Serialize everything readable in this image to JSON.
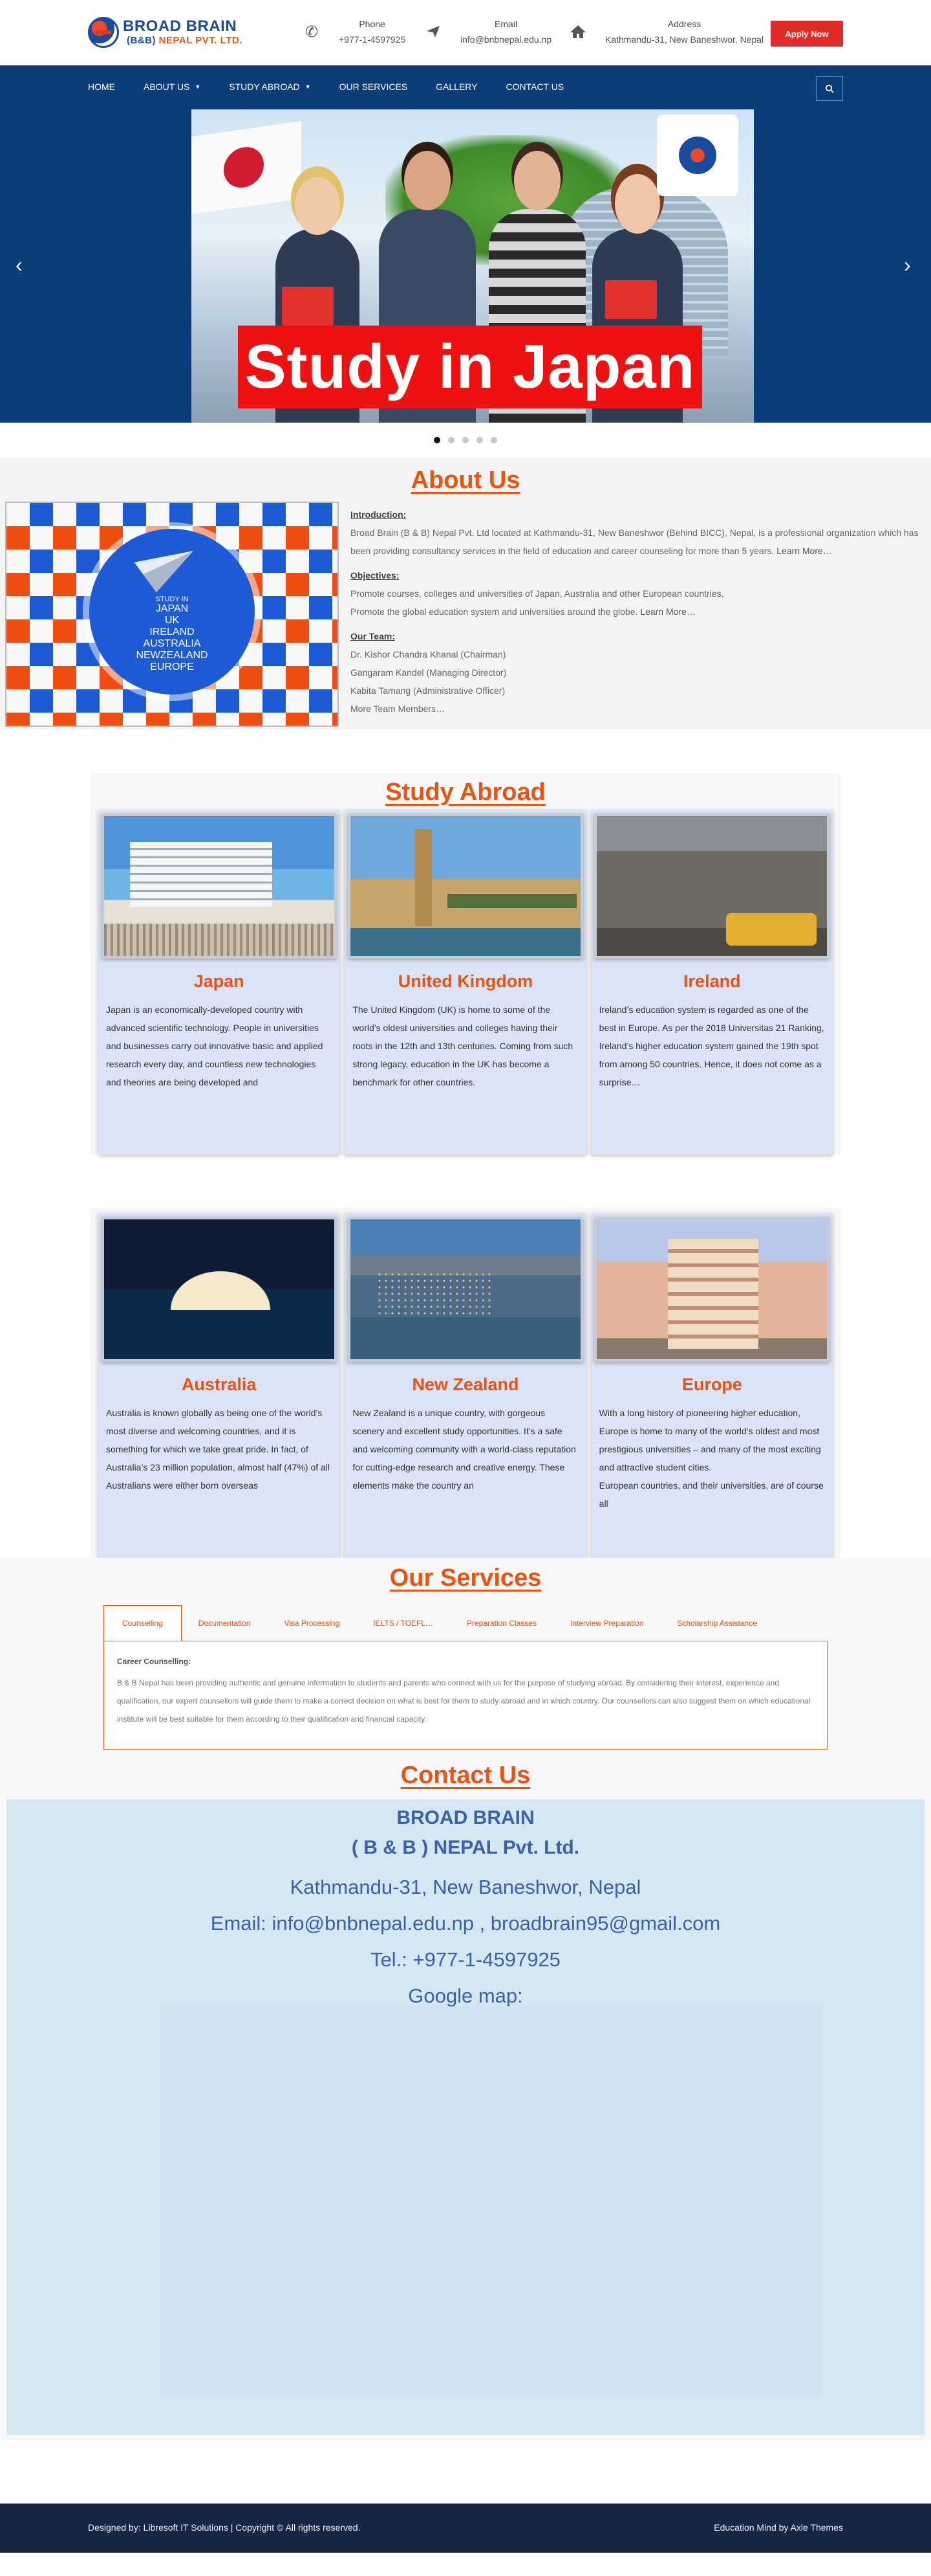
{
  "header": {
    "logo": {
      "line1": "BROAD BRAIN",
      "line2_a": "(B&B)",
      "line2_b": " NEPAL PVT. LTD."
    },
    "phone": {
      "label": "Phone",
      "value": "+977-1-4597925",
      "icon": "phone-icon"
    },
    "email": {
      "label": "Email",
      "value": "info@bnbnepal.edu.np",
      "icon": "paper-plane-icon"
    },
    "address": {
      "label": "Address",
      "value": "Kathmandu-31, New Baneshwor, Nepal",
      "icon": "home-icon"
    },
    "apply_label": "Apply Now"
  },
  "nav": {
    "items": [
      {
        "label": "HOME"
      },
      {
        "label": "ABOUT US"
      },
      {
        "label": "STUDY ABROAD"
      },
      {
        "label": "OUR SERVICES"
      },
      {
        "label": "GALLERY"
      },
      {
        "label": "CONTACT US"
      }
    ],
    "search_icon": "search-icon"
  },
  "slider": {
    "caption": "Study in Japan",
    "prev": "‹",
    "next": "›",
    "dots": 5,
    "active_dot": 1
  },
  "about": {
    "title": "About Us",
    "image_lines": [
      "STUDY IN",
      "JAPAN",
      "UK",
      "IRELAND",
      "AUSTRALIA",
      "NEWZEALAND",
      "EUROPE"
    ],
    "intro_heading": "Introduction:",
    "intro_text": "Broad Brain (B & B) Nepal Pvt. Ltd located at Kathmandu-31, New Baneshwor (Behind BICC), Nepal, is a professional organization which has been providing consultancy services in the field of education and career counseling for more than 5 years.",
    "intro_more": " Learn More…",
    "objectives_heading": "Objectives:",
    "objective_1": "Promote courses, colleges and universities of Japan, Australia and other European countries.",
    "objective_2": "Promote the global education system and universities around the globe.",
    "objective_more": " Learn More…",
    "team_heading": "Our Team:",
    "team_1": "Dr. Kishor Chandra Khanal  (Chairman)",
    "team_2": "Gangaram Kandel  (Managing Director)",
    "team_3": "Kabita Tamang  (Administrative Officer)",
    "team_more": "More Team Members…"
  },
  "abroad": {
    "title": "Study Abroad",
    "cards": [
      {
        "title": "Japan",
        "text": "Japan is an economically-developed country with advanced scientific technology. People in universities and businesses carry out innovative basic and applied research every day, and countless new technologies and theories are being developed and"
      },
      {
        "title": "United Kingdom",
        "text": "The United Kingdom (UK) is home to some of the world’s oldest universities and colleges having their roots in the 12th and 13th centuries. Coming from such strong legacy, education in the UK has become a benchmark for other countries."
      },
      {
        "title": "Ireland",
        "text": "Ireland’s education system is regarded as one of the best in Europe. As per the 2018 Universitas 21 Ranking, Ireland’s higher education system gained the 19th spot from among 50 countries. Hence, it does not come as a surprise…"
      },
      {
        "title": "Australia",
        "text": "Australia is known globally as being one of the world’s most diverse and welcoming countries, and it is something for which we take great pride. In fact, of Australia’s 23 million population, almost half (47%) of all Australians were either born overseas"
      },
      {
        "title": "New Zealand",
        "text": "New Zealand is a unique country, with gorgeous scenery and excellent study opportunities. It’s a safe and welcoming community with a world-class reputation for cutting-edge research and creative energy. These elements make the country an"
      },
      {
        "title": "Europe",
        "text": "With a long history of pioneering higher education, Europe is home to many of the world’s oldest and most prestigious universities – and many of the most exciting and attractive student cities.\nEuropean countries, and their universities, are of course all"
      }
    ]
  },
  "services": {
    "title": "Our Services",
    "tabs": [
      "Counselling",
      "Documentation",
      "Visa Processing",
      "IELTS / TOEFL…",
      "Preparation Classes",
      "Interview Preparation",
      "Scholarship Assistance"
    ],
    "panel_title": "Career Counselling:",
    "panel_text": "B & B Nepal has been providing authentic and genuine information to students and parents who connect with us for the purpose of studying abroad. By considering their interest, experience and qualification, our expert counsellors will guide them to make a correct decision on what is best for them to study abroad and in which country. Our counsellors can also suggest them on which educational institute will be best suitable for them according to their qualification and financial capacity."
  },
  "contact": {
    "title": "Contact Us",
    "name1": "BROAD BRAIN",
    "name2": "( B & B ) NEPAL Pvt. Ltd.",
    "address": "Kathmandu-31, New Baneshwor, Nepal",
    "email": "Email: info@bnbnepal.edu.np , broadbrain95@gmail.com",
    "tel": "Tel.: +977-1-4597925",
    "map_label": "Google map:"
  },
  "footer": {
    "left": "Designed by: Libresoft IT Solutions | Copyright © All rights reserved.",
    "right": "Education Mind by Axle Themes"
  },
  "colors": {
    "accent": "#ea5412",
    "nav_bg": "#0b3d7a",
    "apply_bg": "#e32a2a",
    "footer_bg": "#172643",
    "card_bg": "#dbe4f6",
    "contact_bg": "#d5e7f3"
  }
}
